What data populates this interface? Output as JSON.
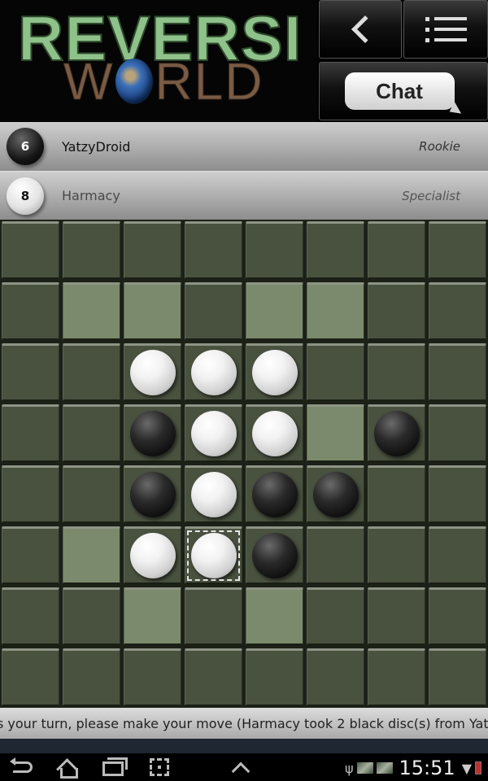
{
  "header": {
    "logo_line1": "REVERSI",
    "logo_line2_prefix": "W",
    "logo_line2_suffix": "RLD",
    "back_icon": "chevron-left-icon",
    "menu_icon": "list-icon",
    "chat_label": "Chat"
  },
  "players": [
    {
      "color": "black",
      "score": "6",
      "name": "YatzyDroid",
      "rank": "Rookie",
      "active": true
    },
    {
      "color": "white",
      "score": "8",
      "name": "Harmacy",
      "rank": "Specialist",
      "active": false
    }
  ],
  "board": {
    "size": 8,
    "rows": [
      [
        "",
        "",
        "",
        "",
        "",
        "",
        "",
        ""
      ],
      [
        "",
        "h",
        "h",
        "",
        "h",
        "h",
        "",
        ""
      ],
      [
        "",
        "",
        "W",
        "W",
        "W",
        "",
        "",
        ""
      ],
      [
        "",
        "",
        "B",
        "W",
        "W",
        "h",
        "B",
        ""
      ],
      [
        "",
        "",
        "B",
        "W",
        "B",
        "B",
        "",
        ""
      ],
      [
        "",
        "h",
        "W",
        "W",
        "B",
        "",
        "",
        ""
      ],
      [
        "",
        "",
        "h",
        "",
        "h",
        "",
        "",
        ""
      ],
      [
        "",
        "",
        "",
        "",
        "",
        "",
        "",
        ""
      ]
    ],
    "legend": {
      "W": "white-disc",
      "B": "black-disc",
      "h": "valid-move-hint"
    },
    "last_move": {
      "row": 5,
      "col": 3
    },
    "colors": {
      "square": "#49513f",
      "hint": "#7b8a6c",
      "grid": "#1b2117"
    }
  },
  "message": "s your turn, please make your move (Harmacy took 2 black disc(s) from Yat",
  "system_bar": {
    "nav_icons": [
      "back-icon",
      "home-icon",
      "recent-apps-icon",
      "screenshot-icon",
      "expand-up-icon"
    ],
    "time": "15:51",
    "status_icons": [
      "usb-icon",
      "notification-thumbnail",
      "notification-thumbnail",
      "wifi-icon",
      "battery-icon"
    ]
  }
}
